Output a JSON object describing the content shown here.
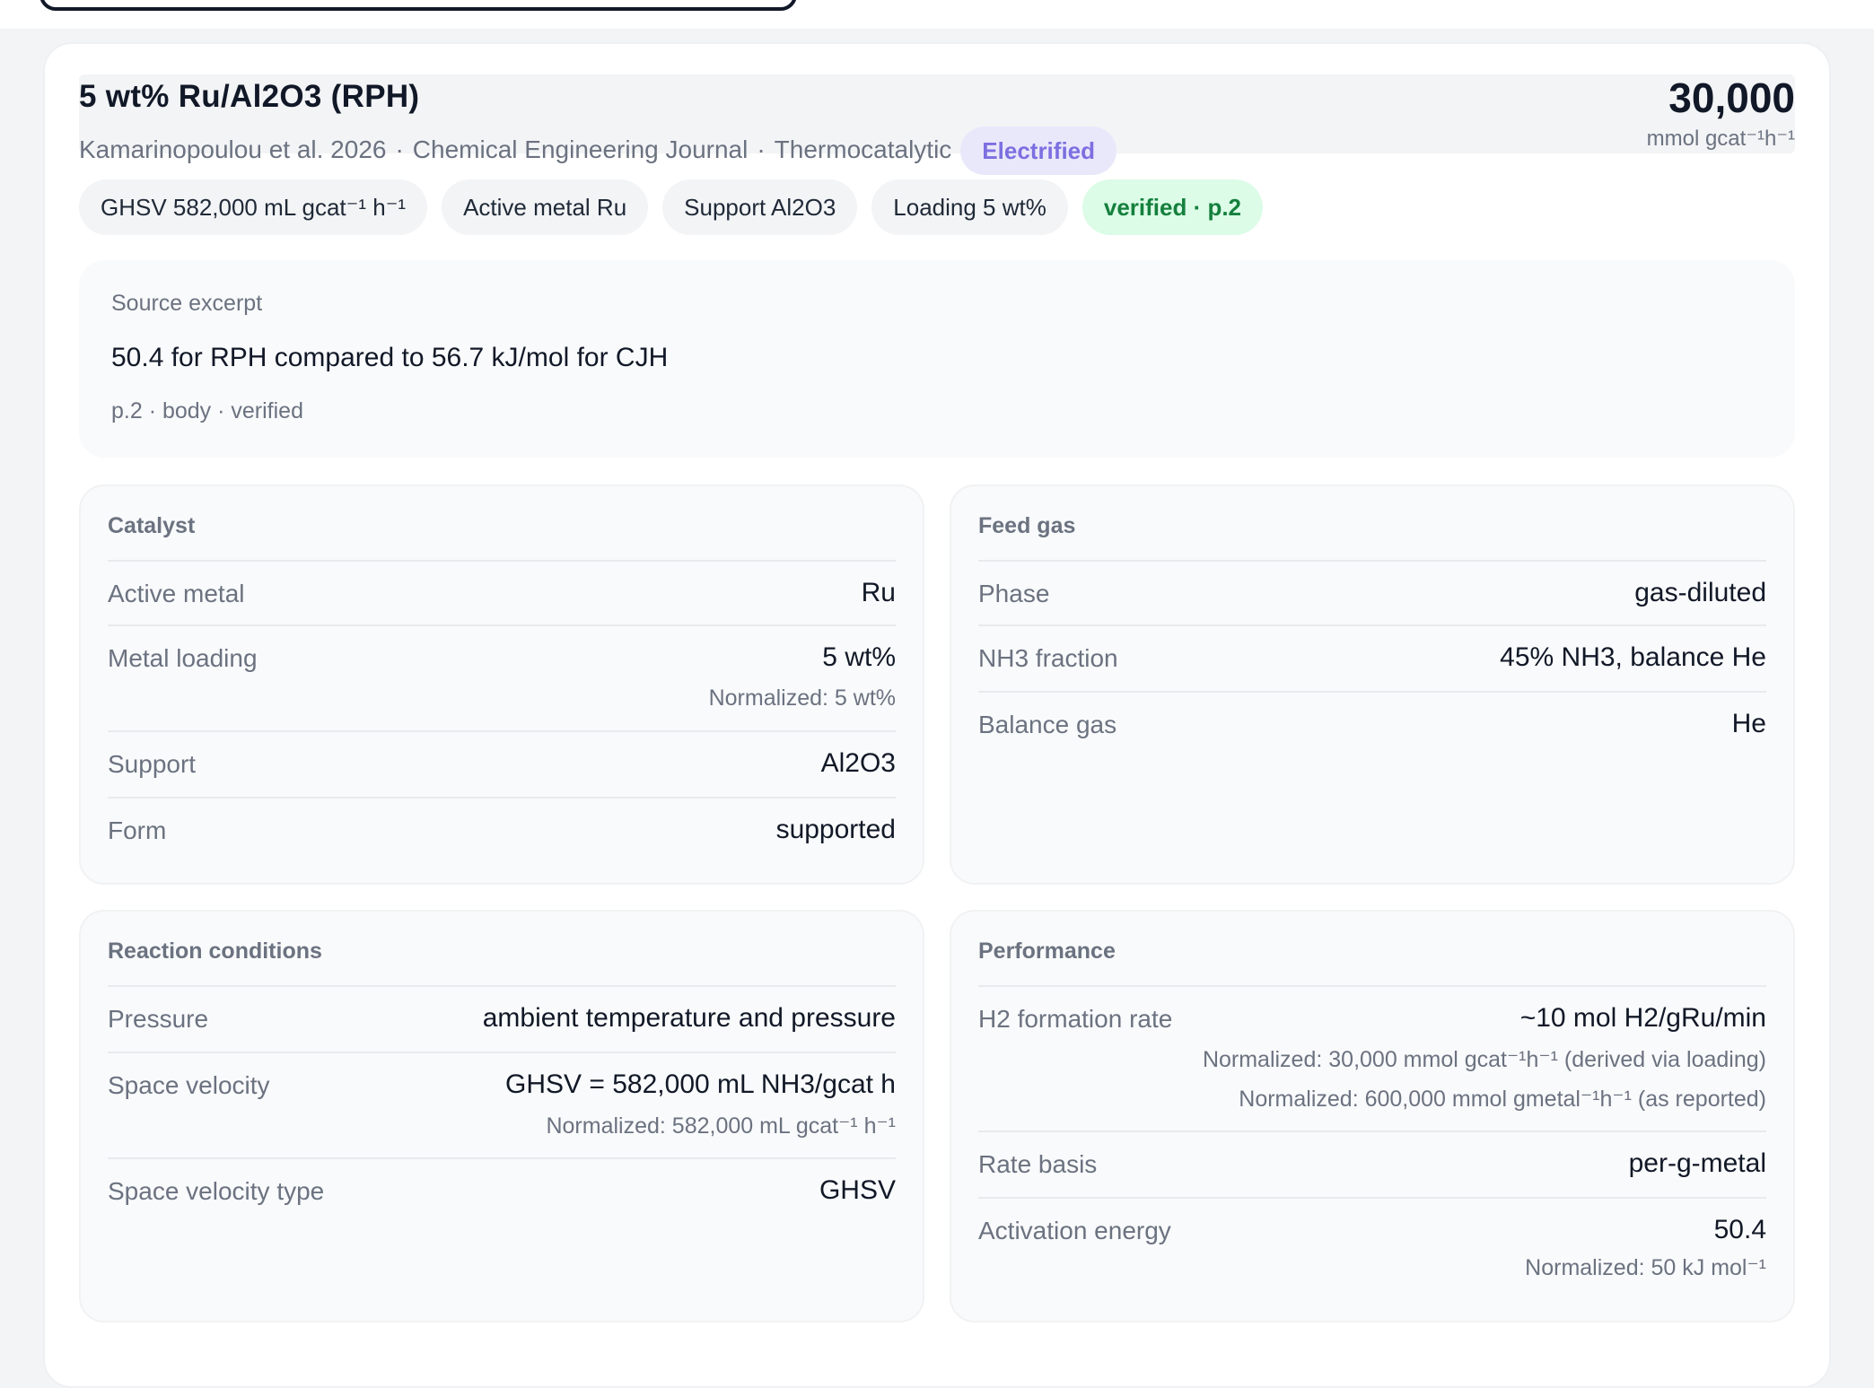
{
  "record": {
    "title": "5 wt% Ru/Al2O3 (RPH)",
    "authors": "Kamarinopoulou et al. 2026",
    "journal": "Chemical Engineering Journal",
    "category": "Thermocatalytic",
    "badge": "Electrified",
    "separator": "·",
    "headline_value": "30,000",
    "headline_unit": "mmol gcat⁻¹h⁻¹"
  },
  "chips": [
    {
      "label": "GHSV 582,000 mL gcat⁻¹ h⁻¹"
    },
    {
      "label": "Active metal Ru"
    },
    {
      "label": "Support Al2O3"
    },
    {
      "label": "Loading 5 wt%"
    },
    {
      "label": "verified · p.2"
    }
  ],
  "excerpt": {
    "label": "Source excerpt",
    "text": "50.4 for RPH compared to 56.7 kJ/mol for CJH",
    "source": "p.2 · body · verified"
  },
  "catalyst": {
    "title": "Catalyst",
    "rows": [
      {
        "key": "Active metal",
        "value": "Ru"
      },
      {
        "key": "Metal loading",
        "value": "5 wt%",
        "note": "Normalized: 5 wt%"
      },
      {
        "key": "Support",
        "value": "Al2O3"
      },
      {
        "key": "Form",
        "value": "supported"
      }
    ]
  },
  "feed": {
    "title": "Feed gas",
    "rows": [
      {
        "key": "Phase",
        "value": "gas-diluted"
      },
      {
        "key": "NH3 fraction",
        "value": "45% NH3, balance He"
      },
      {
        "key": "Balance gas",
        "value": "He"
      }
    ]
  },
  "reaction": {
    "title": "Reaction conditions",
    "rows": [
      {
        "key": "Pressure",
        "value": "ambient temperature and pressure"
      },
      {
        "key": "Space velocity",
        "value": "GHSV = 582,000 mL NH3/gcat h",
        "note": "Normalized: 582,000 mL gcat⁻¹ h⁻¹"
      },
      {
        "key": "Space velocity type",
        "value": "GHSV"
      }
    ]
  },
  "performance": {
    "title": "Performance",
    "rows": [
      {
        "key": "H2 formation rate",
        "value": "~10 mol H2/gRu/min",
        "note": "Normalized: 30,000 mmol gcat⁻¹h⁻¹ (derived via loading)",
        "note2": "Normalized: 600,000 mmol gmetal⁻¹h⁻¹ (as reported)"
      },
      {
        "key": "Rate basis",
        "value": "per-g-metal"
      },
      {
        "key": "Activation energy",
        "value": "50.4",
        "note": "Normalized: 50 kJ mol⁻¹"
      }
    ]
  }
}
